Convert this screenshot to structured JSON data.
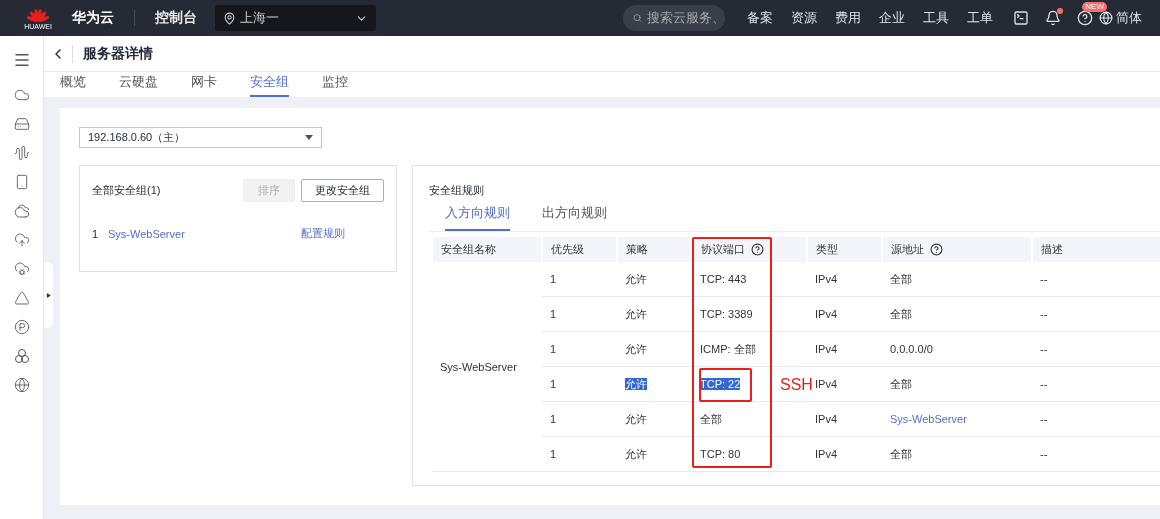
{
  "topbar": {
    "logo_text": "HUAWEI",
    "brand": "华为云",
    "console": "控制台",
    "region": "上海一",
    "search_placeholder": "搜索云服务、",
    "links": [
      "备案",
      "资源",
      "费用",
      "企业",
      "工具",
      "工单"
    ],
    "notification_dot": true,
    "help_badge": "NEW",
    "language": "简体"
  },
  "page": {
    "title": "服务器详情",
    "tabs": [
      {
        "label": "概览",
        "selected": false
      },
      {
        "label": "云硬盘",
        "selected": false
      },
      {
        "label": "网卡",
        "selected": false
      },
      {
        "label": "安全组",
        "selected": true
      },
      {
        "label": "监控",
        "selected": false
      }
    ]
  },
  "nic_select": {
    "value": "192.168.0.60（主）"
  },
  "groups_panel": {
    "title": "全部安全组(1)",
    "buttons": [
      {
        "label": "排序",
        "disabled": true
      },
      {
        "label": "更改安全组",
        "disabled": false
      }
    ],
    "groups": [
      {
        "index": "1",
        "name": "Sys-WebServer",
        "action": "配置规则"
      }
    ]
  },
  "rules_panel": {
    "title": "安全组规则",
    "tabs": [
      {
        "label": "入方向规则",
        "selected": true
      },
      {
        "label": "出方向规则",
        "selected": false
      }
    ],
    "columns": [
      {
        "label": "安全组名称",
        "help": false
      },
      {
        "label": "优先级",
        "help": false
      },
      {
        "label": "策略",
        "help": false
      },
      {
        "label": "协议端口",
        "help": true
      },
      {
        "label": "类型",
        "help": false
      },
      {
        "label": "源地址",
        "help": true
      },
      {
        "label": "描述",
        "help": false
      }
    ],
    "group_name": "Sys-WebServer",
    "rows": [
      {
        "priority": "1",
        "action": "允许",
        "port": "TCP: 443",
        "type": "IPv4",
        "source": "全部",
        "source_link": false,
        "description": "--",
        "selected": false
      },
      {
        "priority": "1",
        "action": "允许",
        "port": "TCP: 3389",
        "type": "IPv4",
        "source": "全部",
        "source_link": false,
        "description": "--",
        "selected": false
      },
      {
        "priority": "1",
        "action": "允许",
        "port": "ICMP: 全部",
        "type": "IPv4",
        "source": "0.0.0.0/0",
        "source_link": false,
        "description": "--",
        "selected": false
      },
      {
        "priority": "1",
        "action": "允许",
        "port": "TCP: 22",
        "type": "IPv4",
        "source": "全部",
        "source_link": false,
        "description": "--",
        "selected": true
      },
      {
        "priority": "1",
        "action": "允许",
        "port": "全部",
        "type": "IPv4",
        "source": "Sys-WebServer",
        "source_link": true,
        "description": "--",
        "selected": false
      },
      {
        "priority": "1",
        "action": "允许",
        "port": "TCP: 80",
        "type": "IPv4",
        "source": "全部",
        "source_link": false,
        "description": "--",
        "selected": false
      }
    ]
  },
  "annotation": {
    "label": "SSH"
  }
}
